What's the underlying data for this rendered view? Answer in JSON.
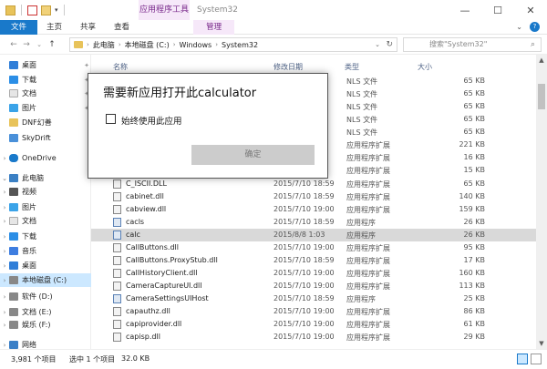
{
  "window": {
    "title": "System32",
    "context_tab_group": "应用程序工具",
    "buttons": {
      "minimize": "—",
      "maximize": "☐",
      "close": "✕"
    }
  },
  "ribbon": {
    "tabs": [
      "文件",
      "主页",
      "共享",
      "查看"
    ],
    "context_tab": "管理",
    "expand": "⌄",
    "help": "?"
  },
  "address": {
    "back": "←",
    "forward": "→",
    "recent": "⌄",
    "up": "↑",
    "crumbs": [
      "此电脑",
      "本地磁盘 (C:)",
      "Windows",
      "System32"
    ],
    "search_placeholder": "搜索\"System32\""
  },
  "nav": {
    "items": [
      {
        "label": "桌面",
        "icon": "desktop-icon",
        "pinned": true
      },
      {
        "label": "下载",
        "icon": "download-icon",
        "pinned": true
      },
      {
        "label": "文档",
        "icon": "document-icon",
        "pinned": true
      },
      {
        "label": "图片",
        "icon": "picture-icon",
        "pinned": true
      },
      {
        "label": "DNF幻善",
        "icon": "folder-icon",
        "pinned": false
      },
      {
        "label": "SkyDrift",
        "icon": "folder-icon",
        "pinned": false
      },
      {
        "label": "OneDrive",
        "icon": "cloud-icon",
        "pinned": false
      },
      {
        "label": "此电脑",
        "icon": "computer-icon",
        "pinned": false
      },
      {
        "label": "视频",
        "icon": "video-icon",
        "pinned": false
      },
      {
        "label": "图片",
        "icon": "picture-icon",
        "pinned": false
      },
      {
        "label": "文档",
        "icon": "document-icon",
        "pinned": false
      },
      {
        "label": "下载",
        "icon": "download-icon",
        "pinned": false
      },
      {
        "label": "音乐",
        "icon": "music-icon",
        "pinned": false
      },
      {
        "label": "桌面",
        "icon": "desktop-icon",
        "pinned": false
      },
      {
        "label": "本地磁盘 (C:)",
        "icon": "disk-icon",
        "pinned": false,
        "selected": true
      },
      {
        "label": "软件 (D:)",
        "icon": "disk-icon",
        "pinned": false
      },
      {
        "label": "文档 (E:)",
        "icon": "disk-icon",
        "pinned": false
      },
      {
        "label": "娱乐 (F:)",
        "icon": "disk-icon",
        "pinned": false
      },
      {
        "label": "网络",
        "icon": "network-icon",
        "pinned": false
      }
    ]
  },
  "list": {
    "columns": {
      "name": "名称",
      "date": "修改日期",
      "type": "类型",
      "size": "大小"
    },
    "top_rows": [
      {
        "type": "NLS 文件",
        "size": "65 KB"
      },
      {
        "type": "NLS 文件",
        "size": "65 KB"
      },
      {
        "type": "NLS 文件",
        "size": "65 KB"
      },
      {
        "type": "NLS 文件",
        "size": "65 KB"
      },
      {
        "type": "NLS 文件",
        "size": "65 KB"
      },
      {
        "type": "应用程序扩展",
        "size": "221 KB"
      },
      {
        "type": "应用程序扩展",
        "size": "16 KB"
      },
      {
        "type": "应用程序扩展",
        "size": "15 KB"
      }
    ],
    "rows": [
      {
        "name": "C_ISCII.DLL",
        "date": "2015/7/10 18:59",
        "type": "应用程序扩展",
        "size": "65 KB",
        "kind": "dll"
      },
      {
        "name": "cabinet.dll",
        "date": "2015/7/10 18:59",
        "type": "应用程序扩展",
        "size": "140 KB",
        "kind": "dll"
      },
      {
        "name": "cabview.dll",
        "date": "2015/7/10 19:00",
        "type": "应用程序扩展",
        "size": "159 KB",
        "kind": "dll"
      },
      {
        "name": "cacls",
        "date": "2015/7/10 18:59",
        "type": "应用程序",
        "size": "26 KB",
        "kind": "exe"
      },
      {
        "name": "calc",
        "date": "2015/8/8 1:03",
        "type": "应用程序",
        "size": "26 KB",
        "kind": "exe",
        "selected": true
      },
      {
        "name": "CallButtons.dll",
        "date": "2015/7/10 19:00",
        "type": "应用程序扩展",
        "size": "95 KB",
        "kind": "dll"
      },
      {
        "name": "CallButtons.ProxyStub.dll",
        "date": "2015/7/10 18:59",
        "type": "应用程序扩展",
        "size": "17 KB",
        "kind": "dll"
      },
      {
        "name": "CallHistoryClient.dll",
        "date": "2015/7/10 19:00",
        "type": "应用程序扩展",
        "size": "160 KB",
        "kind": "dll"
      },
      {
        "name": "CameraCaptureUI.dll",
        "date": "2015/7/10 19:00",
        "type": "应用程序扩展",
        "size": "113 KB",
        "kind": "dll"
      },
      {
        "name": "CameraSettingsUIHost",
        "date": "2015/7/10 18:59",
        "type": "应用程序",
        "size": "25 KB",
        "kind": "exe"
      },
      {
        "name": "capauthz.dll",
        "date": "2015/7/10 19:00",
        "type": "应用程序扩展",
        "size": "86 KB",
        "kind": "dll"
      },
      {
        "name": "capiprovider.dll",
        "date": "2015/7/10 19:00",
        "type": "应用程序扩展",
        "size": "61 KB",
        "kind": "dll"
      },
      {
        "name": "capisp.dll",
        "date": "2015/7/10 19:00",
        "type": "应用程序扩展",
        "size": "29 KB",
        "kind": "dll"
      }
    ]
  },
  "status": {
    "count": "3,981 个项目",
    "selected": "选中 1 个项目",
    "selected_size": "32.0 KB"
  },
  "dialog": {
    "title": "需要新应用打开此calculator",
    "checkbox_label": "始终使用此应用",
    "ok_label": "确定"
  }
}
